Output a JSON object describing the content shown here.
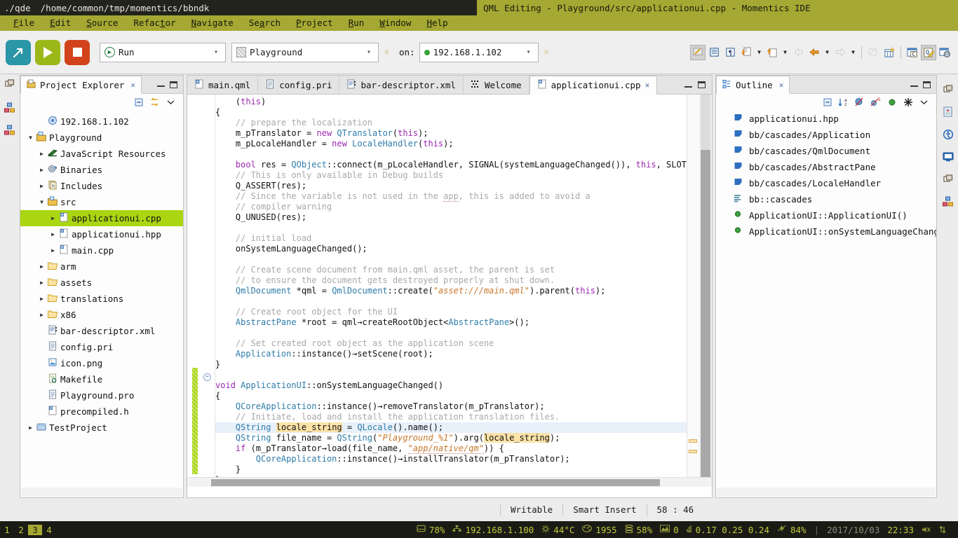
{
  "titlebar": {
    "term_prompt": "./qde",
    "term_path": "/home/common/tmp/momentics/bbndk",
    "window_title": "QML Editing - Playground/src/applicationui.cpp - Momentics IDE"
  },
  "menubar": {
    "items": [
      "File",
      "Edit",
      "Source",
      "Refactor",
      "Navigate",
      "Search",
      "Project",
      "Run",
      "Window",
      "Help"
    ]
  },
  "toolbar": {
    "new_button": "new-icon",
    "run_button": "run-icon",
    "stop_button": "stop-icon",
    "launch_mode": "Run",
    "project": "Playground",
    "on_label": "on:",
    "target": "192.168.1.102",
    "right_icons": [
      "toggle-comment-icon",
      "block-selection-icon",
      "show-whitespace-icon",
      "next-annotation-icon",
      "previous-annotation-icon",
      "back-history-icon",
      "forward-history-icon",
      "pin-editor-icon",
      "new-qml-file-icon",
      "open-c-perspective-icon",
      "open-qml-perspective-icon",
      "open-info-perspective-icon"
    ]
  },
  "left_strip": {
    "icons": [
      "restore-perspective-icon",
      "c-cpp-perspective-icon",
      "momentics-perspective-icon"
    ]
  },
  "right_strip": {
    "icons": [
      "restore-view-icon",
      "problems-view-icon",
      "accessibility-view-icon",
      "console-view-icon",
      "minimize-view-icon",
      "palette-view-icon"
    ]
  },
  "project_explorer": {
    "title": "Project Explorer",
    "tab_icon": "project-explorer-icon",
    "close_icon": "close-icon",
    "tools": [
      "collapse-all-icon",
      "link-with-editor-icon",
      "view-menu-icon"
    ],
    "tree": [
      {
        "indent": 1,
        "arrow": "none",
        "icon": "target-icon",
        "label": "192.168.1.102",
        "selected": false
      },
      {
        "indent": 0,
        "arrow": "expanded",
        "icon": "project-icon",
        "label": "Playground",
        "selected": false
      },
      {
        "indent": 1,
        "arrow": "collapsed",
        "icon": "js-resources-icon",
        "label": "JavaScript Resources",
        "selected": false
      },
      {
        "indent": 1,
        "arrow": "collapsed",
        "icon": "binaries-icon",
        "label": "Binaries",
        "selected": false
      },
      {
        "indent": 1,
        "arrow": "collapsed",
        "icon": "includes-icon",
        "label": "Includes",
        "selected": false
      },
      {
        "indent": 1,
        "arrow": "expanded",
        "icon": "source-folder-icon",
        "label": "src",
        "selected": false
      },
      {
        "indent": 2,
        "arrow": "collapsed",
        "icon": "cpp-file-icon",
        "label": "applicationui.cpp",
        "selected": true
      },
      {
        "indent": 2,
        "arrow": "collapsed",
        "icon": "header-file-icon",
        "label": "applicationui.hpp",
        "selected": false
      },
      {
        "indent": 2,
        "arrow": "collapsed",
        "icon": "cpp-file-icon",
        "label": "main.cpp",
        "selected": false
      },
      {
        "indent": 1,
        "arrow": "collapsed",
        "icon": "folder-icon",
        "label": "arm",
        "selected": false
      },
      {
        "indent": 1,
        "arrow": "collapsed",
        "icon": "folder-icon",
        "label": "assets",
        "selected": false
      },
      {
        "indent": 1,
        "arrow": "collapsed",
        "icon": "folder-icon",
        "label": "translations",
        "selected": false
      },
      {
        "indent": 1,
        "arrow": "collapsed",
        "icon": "folder-icon",
        "label": "x86",
        "selected": false
      },
      {
        "indent": 1,
        "arrow": "none",
        "icon": "xml-file-icon",
        "label": "bar-descriptor.xml",
        "selected": false
      },
      {
        "indent": 1,
        "arrow": "none",
        "icon": "text-file-icon",
        "label": "config.pri",
        "selected": false
      },
      {
        "indent": 1,
        "arrow": "none",
        "icon": "image-file-icon",
        "label": "icon.png",
        "selected": false
      },
      {
        "indent": 1,
        "arrow": "none",
        "icon": "makefile-icon",
        "label": "Makefile",
        "selected": false
      },
      {
        "indent": 1,
        "arrow": "none",
        "icon": "text-file-icon",
        "label": "Playground.pro",
        "selected": false
      },
      {
        "indent": 1,
        "arrow": "none",
        "icon": "header-file-icon",
        "label": "precompiled.h",
        "selected": false
      },
      {
        "indent": 0,
        "arrow": "collapsed",
        "icon": "closed-project-icon",
        "label": "TestProject",
        "selected": false
      }
    ]
  },
  "editor": {
    "tabs": [
      {
        "label": "main.qml",
        "icon": "qml-file-icon",
        "active": false,
        "closable": false
      },
      {
        "label": "config.pri",
        "icon": "text-file-icon",
        "active": false,
        "closable": false
      },
      {
        "label": "bar-descriptor.xml",
        "icon": "xml-file-icon",
        "active": false,
        "closable": false
      },
      {
        "label": "Welcome",
        "icon": "welcome-icon",
        "active": false,
        "closable": false
      },
      {
        "label": "applicationui.cpp",
        "icon": "cpp-file-icon",
        "active": true,
        "closable": true
      }
    ],
    "code_lines": [
      "    (this)",
      "{",
      "    // prepare the localization",
      "    m_pTranslator = new QTranslator(this);",
      "    m_pLocaleHandler = new LocaleHandler(this);",
      "",
      "    bool res = QObject::connect(m_pLocaleHandler, SIGNAL(systemLanguageChanged()), this, SLOT(onSystemLanguageChan",
      "    // This is only available in Debug builds",
      "    Q_ASSERT(res);",
      "    // Since the variable is not used in the app, this is added to avoid a",
      "    // compiler warning",
      "    Q_UNUSED(res);",
      "",
      "    // initial load",
      "    onSystemLanguageChanged();",
      "",
      "    // Create scene document from main.qml asset, the parent is set",
      "    // to ensure the document gets destroyed properly at shut down.",
      "    QmlDocument *qml = QmlDocument::create(\"asset:///main.qml\").parent(this);",
      "",
      "    // Create root object for the UI",
      "    AbstractPane *root = qml→createRootObject<AbstractPane>();",
      "",
      "    // Set created root object as the application scene",
      "    Application::instance()→setScene(root);",
      "}",
      "",
      "void ApplicationUI::onSystemLanguageChanged()",
      "{",
      "    QCoreApplication::instance()→removeTranslator(m_pTranslator);",
      "    // Initiate, load and install the application translation files.",
      "    QString locale_string = QLocale().name();",
      "    QString file_name = QString(\"Playground_%1\").arg(locale_string);",
      "    if (m_pTranslator→load(file_name, \"app/native/qm\")) {",
      "        QCoreApplication::instance()→installTranslator(m_pTranslator);",
      "    }",
      "}"
    ]
  },
  "outline": {
    "title": "Outline",
    "tab_icon": "outline-icon",
    "close_icon": "close-icon",
    "tools": [
      "collapse-all-icon",
      "sort-icon",
      "hide-fields-icon",
      "hide-static-icon",
      "hide-nonpublic-icon",
      "filter-icon",
      "view-menu-icon"
    ],
    "items": [
      {
        "icon": "include-icon",
        "label": "applicationui.hpp"
      },
      {
        "icon": "include-icon",
        "label": "bb/cascades/Application"
      },
      {
        "icon": "include-icon",
        "label": "bb/cascades/QmlDocument"
      },
      {
        "icon": "include-icon",
        "label": "bb/cascades/AbstractPane"
      },
      {
        "icon": "include-icon",
        "label": "bb/cascades/LocaleHandler"
      },
      {
        "icon": "namespace-icon",
        "label": "bb::cascades"
      },
      {
        "icon": "method-icon",
        "label": "ApplicationUI::ApplicationUI()"
      },
      {
        "icon": "method-icon",
        "label": "ApplicationUI::onSystemLanguageChanged"
      }
    ]
  },
  "status_bar": {
    "writable": "Writable",
    "insert_mode": "Smart Insert",
    "position": "58 : 46"
  },
  "system_bar": {
    "workspaces": [
      "1",
      "2",
      "3",
      "4"
    ],
    "active_workspace": "3",
    "disk_icon": "disk-icon",
    "disk": "78%",
    "network_icon": "network-icon",
    "ip": "192.168.1.100",
    "temp_icon": "temperature-icon",
    "temp": "44°C",
    "speed_icon": "gauge-icon",
    "speed": "1955",
    "mem_icon": "memory-icon",
    "mem": "58%",
    "graph_icon": "graph-icon",
    "graph_value": "0",
    "load_icon": "load-icon",
    "load": "0.17 0.25 0.24",
    "battery_icon": "battery-icon",
    "battery": "84%",
    "separator": "|",
    "date": "2017/10/03",
    "time": "22:33",
    "mute_icon": "mute-icon",
    "net_io_icon": "network-io-icon"
  },
  "colors": {
    "accent_olive": "#a5a832",
    "selection_green": "#aad511",
    "terminal_bg": "#23231e",
    "system_bar_bg": "#1b1b16",
    "system_text": "#c2cb3d"
  }
}
